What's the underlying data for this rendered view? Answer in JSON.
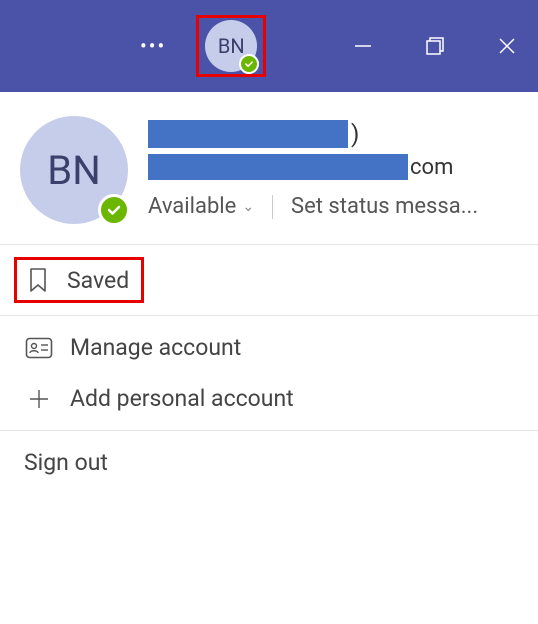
{
  "titlebar": {
    "avatar_initials": "BN"
  },
  "profile": {
    "avatar_initials": "BN",
    "name_suffix": ")",
    "email_suffix": "com",
    "status_label": "Available",
    "status_message_label": "Set status messa..."
  },
  "menu": {
    "saved_label": "Saved",
    "manage_account_label": "Manage account",
    "add_personal_label": "Add personal account",
    "sign_out_label": "Sign out"
  }
}
